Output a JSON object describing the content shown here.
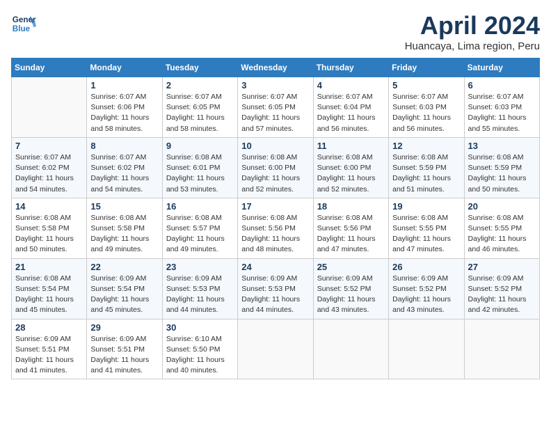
{
  "header": {
    "logo_line1": "General",
    "logo_line2": "Blue",
    "month_title": "April 2024",
    "location": "Huancaya, Lima region, Peru"
  },
  "weekdays": [
    "Sunday",
    "Monday",
    "Tuesday",
    "Wednesday",
    "Thursday",
    "Friday",
    "Saturday"
  ],
  "weeks": [
    [
      {
        "day": "",
        "sunrise": "",
        "sunset": "",
        "daylight": ""
      },
      {
        "day": "1",
        "sunrise": "Sunrise: 6:07 AM",
        "sunset": "Sunset: 6:06 PM",
        "daylight": "Daylight: 11 hours and 58 minutes."
      },
      {
        "day": "2",
        "sunrise": "Sunrise: 6:07 AM",
        "sunset": "Sunset: 6:05 PM",
        "daylight": "Daylight: 11 hours and 58 minutes."
      },
      {
        "day": "3",
        "sunrise": "Sunrise: 6:07 AM",
        "sunset": "Sunset: 6:05 PM",
        "daylight": "Daylight: 11 hours and 57 minutes."
      },
      {
        "day": "4",
        "sunrise": "Sunrise: 6:07 AM",
        "sunset": "Sunset: 6:04 PM",
        "daylight": "Daylight: 11 hours and 56 minutes."
      },
      {
        "day": "5",
        "sunrise": "Sunrise: 6:07 AM",
        "sunset": "Sunset: 6:03 PM",
        "daylight": "Daylight: 11 hours and 56 minutes."
      },
      {
        "day": "6",
        "sunrise": "Sunrise: 6:07 AM",
        "sunset": "Sunset: 6:03 PM",
        "daylight": "Daylight: 11 hours and 55 minutes."
      }
    ],
    [
      {
        "day": "7",
        "sunrise": "Sunrise: 6:07 AM",
        "sunset": "Sunset: 6:02 PM",
        "daylight": "Daylight: 11 hours and 54 minutes."
      },
      {
        "day": "8",
        "sunrise": "Sunrise: 6:07 AM",
        "sunset": "Sunset: 6:02 PM",
        "daylight": "Daylight: 11 hours and 54 minutes."
      },
      {
        "day": "9",
        "sunrise": "Sunrise: 6:08 AM",
        "sunset": "Sunset: 6:01 PM",
        "daylight": "Daylight: 11 hours and 53 minutes."
      },
      {
        "day": "10",
        "sunrise": "Sunrise: 6:08 AM",
        "sunset": "Sunset: 6:00 PM",
        "daylight": "Daylight: 11 hours and 52 minutes."
      },
      {
        "day": "11",
        "sunrise": "Sunrise: 6:08 AM",
        "sunset": "Sunset: 6:00 PM",
        "daylight": "Daylight: 11 hours and 52 minutes."
      },
      {
        "day": "12",
        "sunrise": "Sunrise: 6:08 AM",
        "sunset": "Sunset: 5:59 PM",
        "daylight": "Daylight: 11 hours and 51 minutes."
      },
      {
        "day": "13",
        "sunrise": "Sunrise: 6:08 AM",
        "sunset": "Sunset: 5:59 PM",
        "daylight": "Daylight: 11 hours and 50 minutes."
      }
    ],
    [
      {
        "day": "14",
        "sunrise": "Sunrise: 6:08 AM",
        "sunset": "Sunset: 5:58 PM",
        "daylight": "Daylight: 11 hours and 50 minutes."
      },
      {
        "day": "15",
        "sunrise": "Sunrise: 6:08 AM",
        "sunset": "Sunset: 5:58 PM",
        "daylight": "Daylight: 11 hours and 49 minutes."
      },
      {
        "day": "16",
        "sunrise": "Sunrise: 6:08 AM",
        "sunset": "Sunset: 5:57 PM",
        "daylight": "Daylight: 11 hours and 49 minutes."
      },
      {
        "day": "17",
        "sunrise": "Sunrise: 6:08 AM",
        "sunset": "Sunset: 5:56 PM",
        "daylight": "Daylight: 11 hours and 48 minutes."
      },
      {
        "day": "18",
        "sunrise": "Sunrise: 6:08 AM",
        "sunset": "Sunset: 5:56 PM",
        "daylight": "Daylight: 11 hours and 47 minutes."
      },
      {
        "day": "19",
        "sunrise": "Sunrise: 6:08 AM",
        "sunset": "Sunset: 5:55 PM",
        "daylight": "Daylight: 11 hours and 47 minutes."
      },
      {
        "day": "20",
        "sunrise": "Sunrise: 6:08 AM",
        "sunset": "Sunset: 5:55 PM",
        "daylight": "Daylight: 11 hours and 46 minutes."
      }
    ],
    [
      {
        "day": "21",
        "sunrise": "Sunrise: 6:08 AM",
        "sunset": "Sunset: 5:54 PM",
        "daylight": "Daylight: 11 hours and 45 minutes."
      },
      {
        "day": "22",
        "sunrise": "Sunrise: 6:09 AM",
        "sunset": "Sunset: 5:54 PM",
        "daylight": "Daylight: 11 hours and 45 minutes."
      },
      {
        "day": "23",
        "sunrise": "Sunrise: 6:09 AM",
        "sunset": "Sunset: 5:53 PM",
        "daylight": "Daylight: 11 hours and 44 minutes."
      },
      {
        "day": "24",
        "sunrise": "Sunrise: 6:09 AM",
        "sunset": "Sunset: 5:53 PM",
        "daylight": "Daylight: 11 hours and 44 minutes."
      },
      {
        "day": "25",
        "sunrise": "Sunrise: 6:09 AM",
        "sunset": "Sunset: 5:52 PM",
        "daylight": "Daylight: 11 hours and 43 minutes."
      },
      {
        "day": "26",
        "sunrise": "Sunrise: 6:09 AM",
        "sunset": "Sunset: 5:52 PM",
        "daylight": "Daylight: 11 hours and 43 minutes."
      },
      {
        "day": "27",
        "sunrise": "Sunrise: 6:09 AM",
        "sunset": "Sunset: 5:52 PM",
        "daylight": "Daylight: 11 hours and 42 minutes."
      }
    ],
    [
      {
        "day": "28",
        "sunrise": "Sunrise: 6:09 AM",
        "sunset": "Sunset: 5:51 PM",
        "daylight": "Daylight: 11 hours and 41 minutes."
      },
      {
        "day": "29",
        "sunrise": "Sunrise: 6:09 AM",
        "sunset": "Sunset: 5:51 PM",
        "daylight": "Daylight: 11 hours and 41 minutes."
      },
      {
        "day": "30",
        "sunrise": "Sunrise: 6:10 AM",
        "sunset": "Sunset: 5:50 PM",
        "daylight": "Daylight: 11 hours and 40 minutes."
      },
      {
        "day": "",
        "sunrise": "",
        "sunset": "",
        "daylight": ""
      },
      {
        "day": "",
        "sunrise": "",
        "sunset": "",
        "daylight": ""
      },
      {
        "day": "",
        "sunrise": "",
        "sunset": "",
        "daylight": ""
      },
      {
        "day": "",
        "sunrise": "",
        "sunset": "",
        "daylight": ""
      }
    ]
  ]
}
